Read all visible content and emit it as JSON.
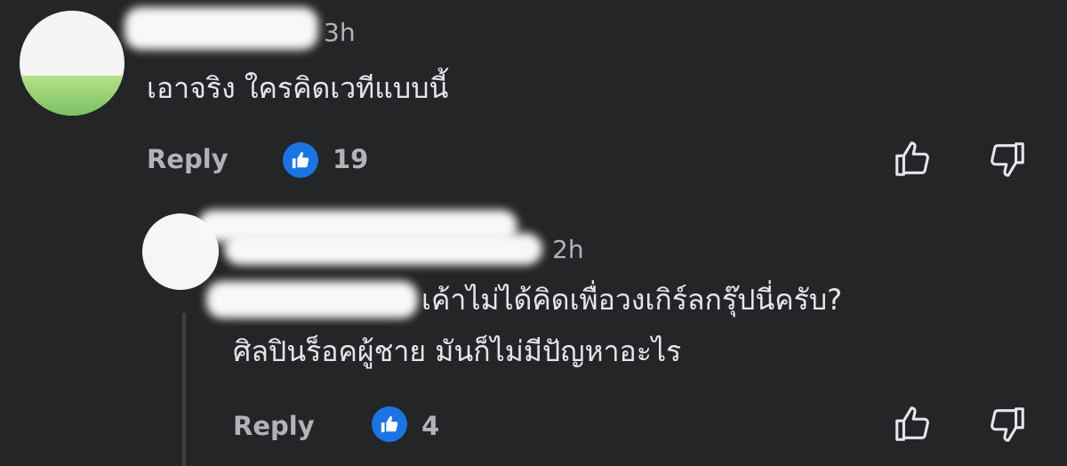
{
  "comments": [
    {
      "time": "3h",
      "text": "เอาจริง ใครคิดเวทีแบบนี้",
      "reply_label": "Reply",
      "likes": "19"
    },
    {
      "time": "2h",
      "text_line1": "เค้าไม่ได้คิดเพื่อวงเกิร์ลกรุ๊ปนี่ครับ?",
      "text_line2": "ศิลปินร็อคผู้ชาย มันก็ไม่มีปัญหาอะไร",
      "reply_label": "Reply",
      "likes": "4"
    }
  ],
  "colors": {
    "background": "#242526",
    "primary_text": "#e4e6eb",
    "secondary_text": "#b0b3b8",
    "like_blue": "#1b74e4"
  },
  "icons": {
    "like_badge": "thumbs-up-icon",
    "upvote": "thumbs-up-outline-icon",
    "downvote": "thumbs-down-outline-icon"
  }
}
